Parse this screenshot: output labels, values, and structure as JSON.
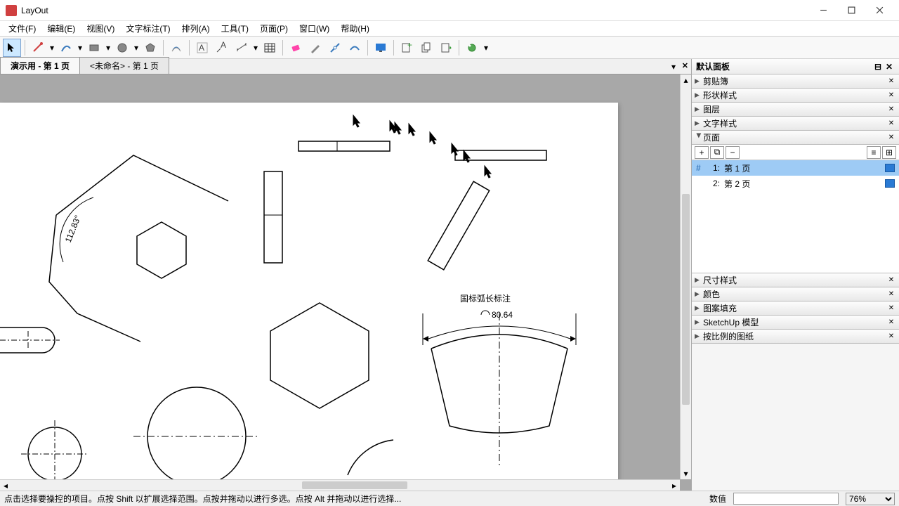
{
  "window": {
    "title": "LayOut"
  },
  "menus": {
    "file": "文件(F)",
    "edit": "编辑(E)",
    "view": "视图(V)",
    "text": "文字标注(T)",
    "arrange": "排列(A)",
    "tools": "工具(T)",
    "page": "页面(P)",
    "window": "窗口(W)",
    "help": "帮助(H)"
  },
  "tabs": {
    "active": "演示用 - 第 1 页",
    "inactive": "<未命名> - 第 1 页"
  },
  "side": {
    "panel_title": "默认面板",
    "scrapbook": "剪贴簿",
    "shape_style": "形状样式",
    "layers": "图层",
    "text_style": "文字样式",
    "pages": "页面",
    "dimension_style": "尺寸样式",
    "color": "颜色",
    "pattern_fill": "图案填充",
    "sketchup_model": "SketchUp 模型",
    "scaled_drawing": "按比例的图纸"
  },
  "pages": {
    "items": [
      {
        "index": "1:",
        "name": "第 1 页"
      },
      {
        "index": "2:",
        "name": "第 2 页"
      }
    ]
  },
  "canvas": {
    "angle_label": "112.83°",
    "arc_title": "国标弧长标注",
    "arc_value": "80.64"
  },
  "status": {
    "hint": "点击选择要操控的项目。点按 Shift 以扩展选择范围。点按并拖动以进行多选。点按 Alt 并拖动以进行选择...",
    "value_label": "数值",
    "value": "",
    "zoom": "76%"
  }
}
